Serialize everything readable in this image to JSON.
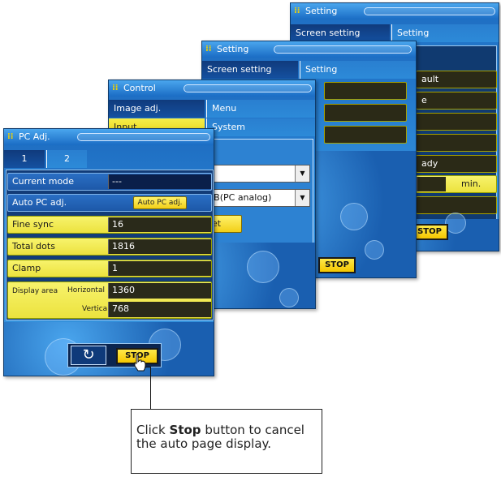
{
  "setting_back": {
    "title": "Setting",
    "tabs": [
      "Screen setting",
      "Setting"
    ],
    "rows": [
      "ault",
      "e",
      "",
      "",
      "ady"
    ],
    "unit": "min.",
    "stop_label": "STOP"
  },
  "setting_front": {
    "title": "Setting",
    "tabs": [
      "Screen setting",
      "Setting"
    ],
    "stop_label": "STOP"
  },
  "control": {
    "title": "Control",
    "tabs": [
      "Image adj.",
      "Menu",
      "Input",
      "System"
    ],
    "input_select": "",
    "source_select": "RGB(PC analog)",
    "button_label": "et"
  },
  "pc_adj": {
    "title": "PC Adj.",
    "tabs": [
      "1",
      "2"
    ],
    "current_mode_label": "Current mode",
    "current_mode_value": "---",
    "auto_pc_label": "Auto PC adj.",
    "auto_pc_button": "Auto PC adj.",
    "fine_sync_label": "Fine sync",
    "fine_sync_value": "16",
    "total_dots_label": "Total dots",
    "total_dots_value": "1816",
    "clamp_label": "Clamp",
    "clamp_value": "1",
    "display_area_label": "Display area",
    "horizontal_label": "Horizontal",
    "horizontal_value": "1360",
    "vertical_label": "Vertical",
    "vertical_value": "768",
    "stop_label": "STOP"
  },
  "callout": {
    "prefix": "Click ",
    "bold": "Stop",
    "suffix": " button to cancel the auto page display."
  },
  "colors": {
    "title_blue": "#1a6cc4",
    "row_yellow": "#ece23e",
    "stop_yellow": "#f5c700"
  }
}
